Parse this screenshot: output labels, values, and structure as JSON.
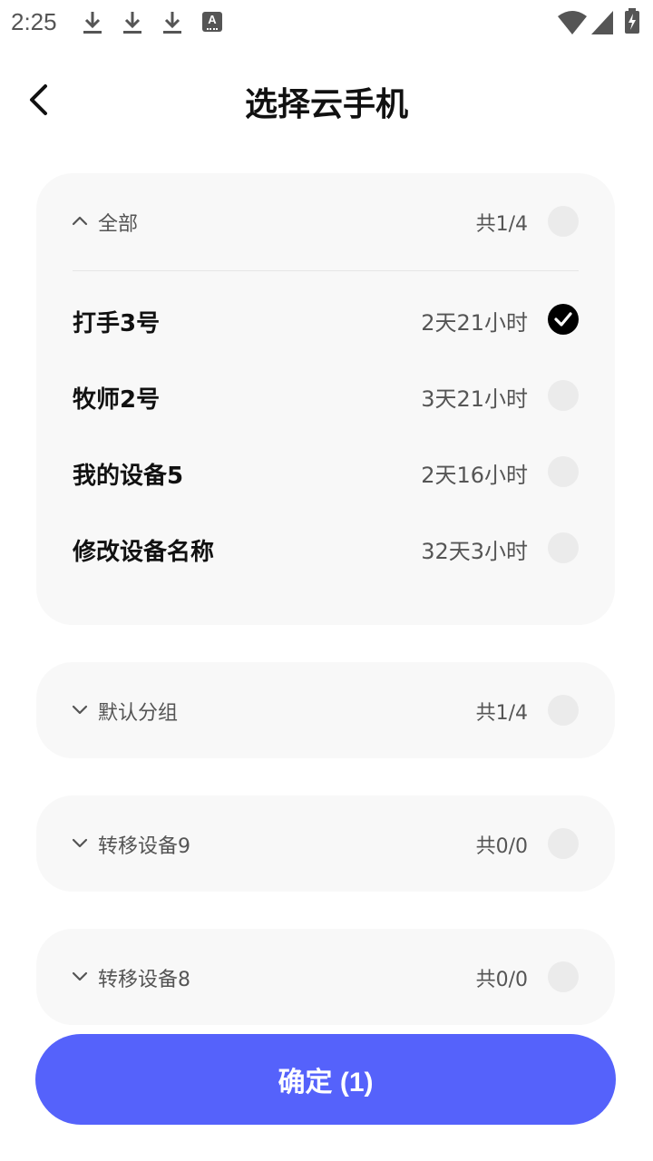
{
  "status_bar": {
    "time": "2:25",
    "icons": [
      "download-icon",
      "download-icon",
      "download-icon",
      "accessibility-a-icon",
      "wifi-icon",
      "signal-icon",
      "battery-charging-icon"
    ],
    "a_glyph": "A"
  },
  "header": {
    "title": "选择云手机",
    "back_icon": "chevron-left-icon"
  },
  "groups": [
    {
      "name": "全部",
      "count": "共1/4",
      "expanded": true,
      "devices": [
        {
          "name": "打手3号",
          "time": "2天21小时",
          "selected": true
        },
        {
          "name": "牧师2号",
          "time": "3天21小时",
          "selected": false
        },
        {
          "name": "我的设备5",
          "time": "2天16小时",
          "selected": false
        },
        {
          "name": "修改设备名称",
          "time": "32天3小时",
          "selected": false
        }
      ]
    },
    {
      "name": "默认分组",
      "count": "共1/4",
      "expanded": false
    },
    {
      "name": "转移设备9",
      "count": "共0/0",
      "expanded": false
    },
    {
      "name": "转移设备8",
      "count": "共0/0",
      "expanded": false
    }
  ],
  "confirm_button": {
    "label": "确定 (1)"
  },
  "colors": {
    "accent": "#5562fb",
    "card_bg": "#f8f8f8",
    "radio_bg": "#ebebeb",
    "secondary_text": "#555555"
  }
}
